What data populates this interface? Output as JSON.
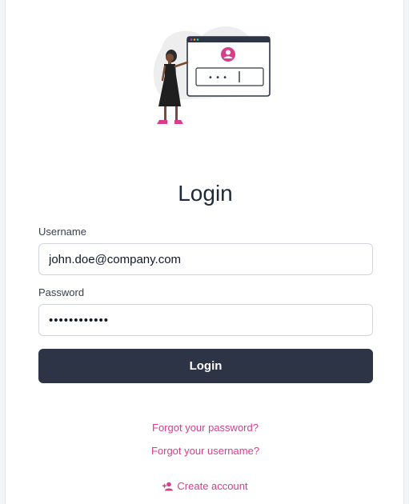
{
  "login": {
    "title": "Login",
    "username_label": "Username",
    "username_value": "john.doe@company.com",
    "password_label": "Password",
    "password_value": "••••••••••••",
    "submit_label": "Login",
    "forgot_password": "Forgot your password?",
    "forgot_username": "Forgot your username?",
    "create_account": "Create account"
  },
  "illustration": {
    "icon": "login-illustration-icon",
    "password_dots": "• • •"
  },
  "theme": {
    "accent": "#d63f8c",
    "button": "#2c3446",
    "text": "#1f2937"
  }
}
